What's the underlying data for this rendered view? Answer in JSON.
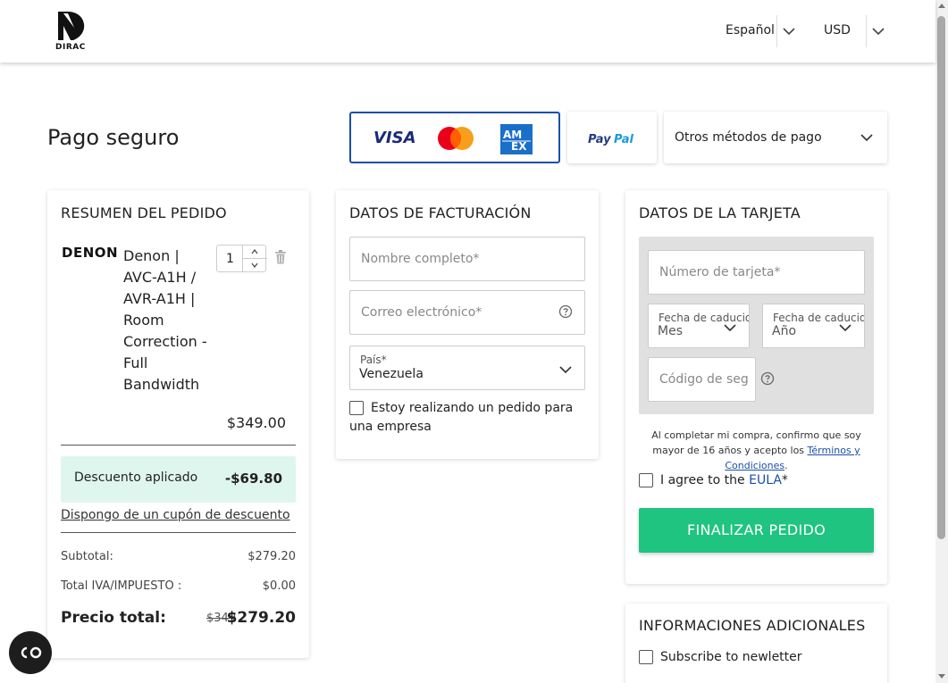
{
  "header": {
    "logo_text": "DIRAC",
    "language": "Español",
    "currency": "USD",
    "chevron_icon": "chevron-down-icon"
  },
  "page_title": "Pago seguro",
  "payment_methods": {
    "cards": [
      "VISA",
      "Mastercard",
      "AMEX"
    ],
    "paypal": "PayPal",
    "other": "Otros métodos de pago"
  },
  "order_summary": {
    "title": "RESUMEN DEL PEDIDO",
    "brand_logo": "DENON",
    "product_lines": [
      "Denon |",
      "AVC-A1H /",
      "AVR-A1H |",
      "Room",
      "Correction -",
      "Full",
      "Bandwidth"
    ],
    "quantity": "1",
    "price": "$349.00",
    "discount_label": "Descuento aplicado",
    "discount_value": "-$69.80",
    "coupon_link": "Dispongo de un cupón de descuento",
    "subtotal_label": "Subtotal:",
    "subtotal_value": "$279.20",
    "tax_label": "Total IVA/IMPUESTO :",
    "tax_value": "$0.00",
    "total_label": "Precio total:",
    "total_original": "$349",
    "total_value": "$279.20"
  },
  "billing": {
    "title": "DATOS DE FACTURACIÓN",
    "name_placeholder": "Nombre completo*",
    "email_placeholder": "Correo electrónico*",
    "country_label": "País*",
    "country_value": "Venezuela",
    "company_checkbox": "Estoy realizando un pedido para una empresa"
  },
  "card": {
    "title": "DATOS DE LA TARJETA",
    "number_placeholder": "Número de tarjeta*",
    "expiry_label": "Fecha de caducidad*",
    "month_value": "Mes",
    "year_value": "Año",
    "cvc_placeholder": "Código de seg",
    "legal_prefix": "Al completar mi compra, confirmo que soy mayor de 16 años y acepto los ",
    "legal_link": "Términos y Condiciones",
    "legal_suffix": ".",
    "eula_prefix": "I agree to the ",
    "eula_link": "EULA",
    "eula_suffix": "*",
    "submit": "FINALIZAR PEDIDO"
  },
  "additional": {
    "title": "INFORMACIONES ADICIONALES",
    "newsletter": "Subscribe to newletter"
  },
  "colors": {
    "accent_green": "#1ec47f",
    "discount_bg": "#dff6ee",
    "card_border_blue": "#1a4fa8",
    "link_blue": "#1a4fa8"
  }
}
